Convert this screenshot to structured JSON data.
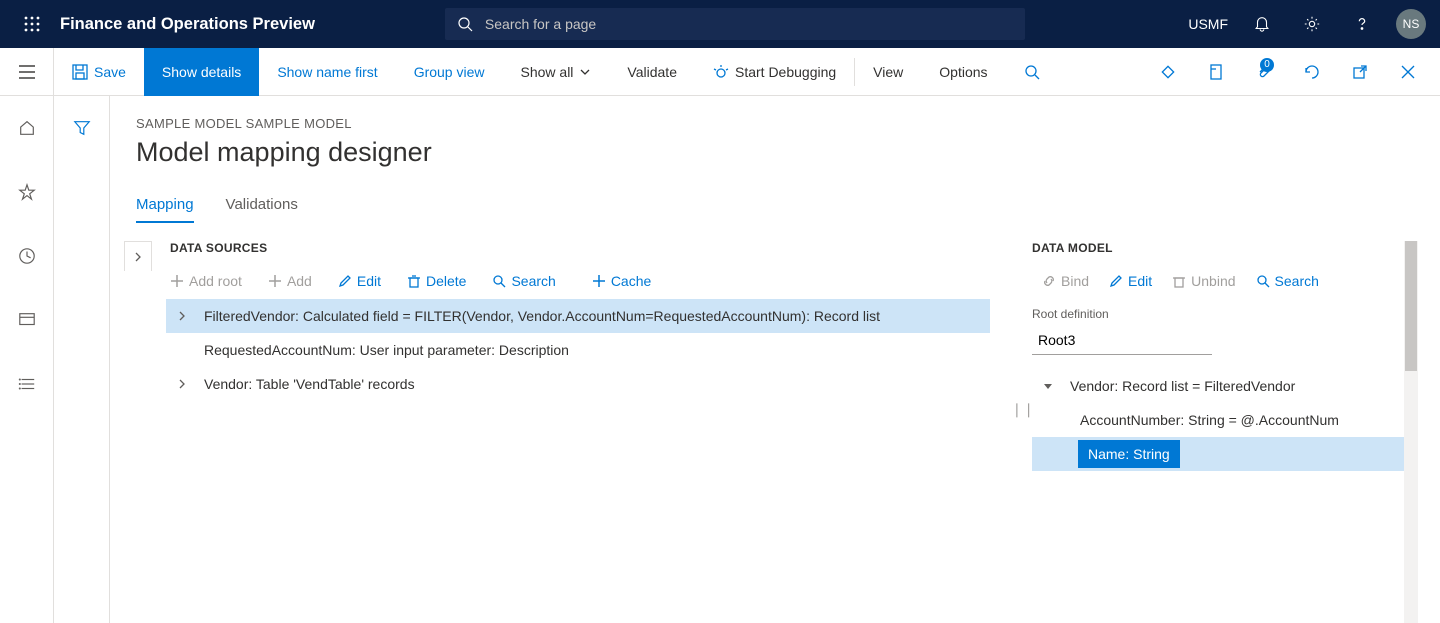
{
  "header": {
    "title": "Finance and Operations Preview",
    "search_placeholder": "Search for a page",
    "company": "USMF",
    "avatar": "NS"
  },
  "toolbar": {
    "save": "Save",
    "show_details": "Show details",
    "show_name_first": "Show name first",
    "group_view": "Group view",
    "show_all": "Show all",
    "validate": "Validate",
    "start_debugging": "Start Debugging",
    "view": "View",
    "options": "Options",
    "attachments_badge": "0"
  },
  "page": {
    "breadcrumb": "SAMPLE MODEL SAMPLE MODEL",
    "title": "Model mapping designer"
  },
  "tabs": {
    "mapping": "Mapping",
    "validations": "Validations"
  },
  "ds": {
    "section": "DATA SOURCES",
    "add_root": "Add root",
    "add": "Add",
    "edit": "Edit",
    "delete": "Delete",
    "search": "Search",
    "cache": "Cache",
    "row0": "FilteredVendor: Calculated field = FILTER(Vendor, Vendor.AccountNum=RequestedAccountNum): Record list",
    "row1": "RequestedAccountNum: User input parameter: Description",
    "row2": "Vendor: Table 'VendTable' records"
  },
  "dm": {
    "section": "DATA MODEL",
    "bind": "Bind",
    "edit": "Edit",
    "unbind": "Unbind",
    "search": "Search",
    "root_label": "Root definition",
    "root_value": "Root3",
    "row0": "Vendor: Record list = FilteredVendor",
    "row1": "AccountNumber: String = @.AccountNum",
    "row2": "Name: String"
  }
}
